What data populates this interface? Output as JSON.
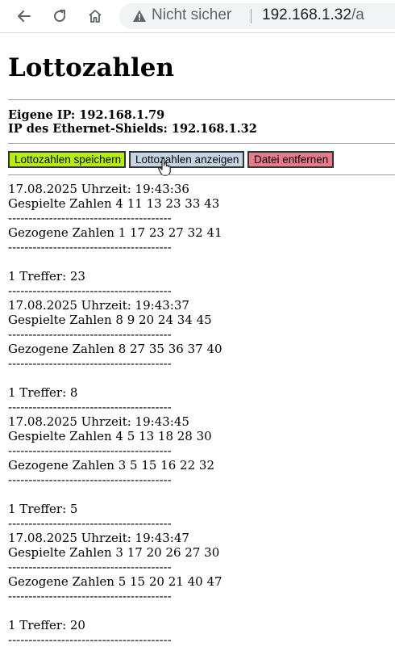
{
  "browser": {
    "security_label": "Nicht sicher",
    "url_host": "192.168.1.32",
    "url_rest": "/a",
    "back_icon": "arrow-left-icon",
    "reload_icon": "reload-icon",
    "home_icon": "home-icon",
    "warning_icon": "warning-triangle-icon"
  },
  "page": {
    "title": "Lottozahlen",
    "own_ip": "Eigene IP: 192.168.1.79",
    "shield_ip": "IP des Ethernet-Shields: 192.168.1.32"
  },
  "buttons": {
    "save": "Lottozahlen speichern",
    "show": "Lottozahlen anzeigen",
    "delete": "Datei entfernen"
  },
  "colors": {
    "save_button": "#b6f000",
    "show_button": "#c4d4e4",
    "delete_button": "#e87a8c"
  },
  "separator": "----------------------------------------",
  "entries": [
    {
      "timestamp": "17.08.2025 Uhrzeit: 19:43:36",
      "played": "Gespielte Zahlen 4 11 13 23 33 43",
      "drawn": "Gezogene Zahlen 1 17 23 27 32 41",
      "hits": "1 Treffer: 23"
    },
    {
      "timestamp": "17.08.2025 Uhrzeit: 19:43:37",
      "played": "Gespielte Zahlen 8 9 20 24 34 45",
      "drawn": "Gezogene Zahlen 8 27 35 36 37 40",
      "hits": "1 Treffer: 8"
    },
    {
      "timestamp": "17.08.2025 Uhrzeit: 19:43:45",
      "played": "Gespielte Zahlen 4 5 13 18 28 30",
      "drawn": "Gezogene Zahlen 3 5 15 16 22 32",
      "hits": "1 Treffer: 5"
    },
    {
      "timestamp": "17.08.2025 Uhrzeit: 19:43:47",
      "played": "Gespielte Zahlen 3 17 20 26 27 30",
      "drawn": "Gezogene Zahlen 5 15 20 21 40 47",
      "hits": "1 Treffer: 20"
    }
  ]
}
